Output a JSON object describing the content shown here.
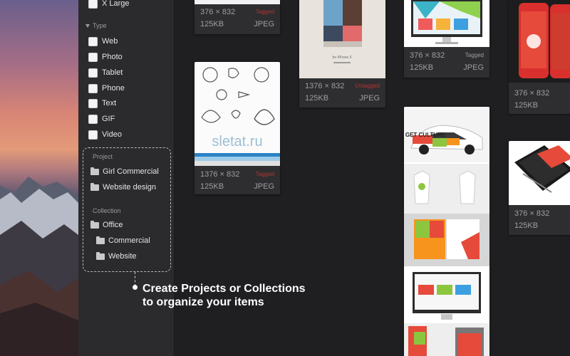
{
  "sidebar": {
    "size_items": [
      {
        "label": "X Large"
      }
    ],
    "type_title": "Type",
    "type_items": [
      {
        "label": "Web"
      },
      {
        "label": "Photo"
      },
      {
        "label": "Tablet"
      },
      {
        "label": "Phone"
      },
      {
        "label": "Text"
      },
      {
        "label": "GIF"
      },
      {
        "label": "Video"
      }
    ],
    "project_title": "Project",
    "projects": [
      {
        "label": "Girl Commercial"
      },
      {
        "label": "Website design"
      }
    ],
    "collection_title": "Collection",
    "collections": [
      {
        "label": "Office"
      },
      {
        "label": "Commercial"
      },
      {
        "label": "Website"
      }
    ]
  },
  "tagline": {
    "line1": "Create Projects or Collections",
    "line2": "to organize your items"
  },
  "cards": [
    {
      "id": "card1",
      "dimensions": "376 × 832",
      "tag": "Tagged",
      "size": "125KB",
      "format": "JPEG"
    },
    {
      "id": "card2",
      "dimensions": "1376 × 832",
      "tag": "Untagged",
      "size": "125KB",
      "format": "JPEG",
      "thumb_caption": "for iPhone 6"
    },
    {
      "id": "card3",
      "dimensions": "376 × 832",
      "tag": "Tagged",
      "size": "125KB",
      "format": "JPEG"
    },
    {
      "id": "card4",
      "dimensions": "376 × 832",
      "size": "125KB"
    },
    {
      "id": "card5",
      "dimensions": "1376 × 832",
      "tag": "Tagged",
      "size": "125KB",
      "format": "JPEG",
      "thumb_text": "sletat.ru"
    },
    {
      "id": "card6",
      "thumb_text": "GET CULTURE"
    },
    {
      "id": "card7",
      "dimensions": "376 × 832",
      "size": "125KB"
    }
  ],
  "colors": {
    "sidebar_bg": "#2b2b2e",
    "grid_bg": "#1f1f21",
    "card_bg": "#2e2e31",
    "tag_red": "#b9322b"
  }
}
